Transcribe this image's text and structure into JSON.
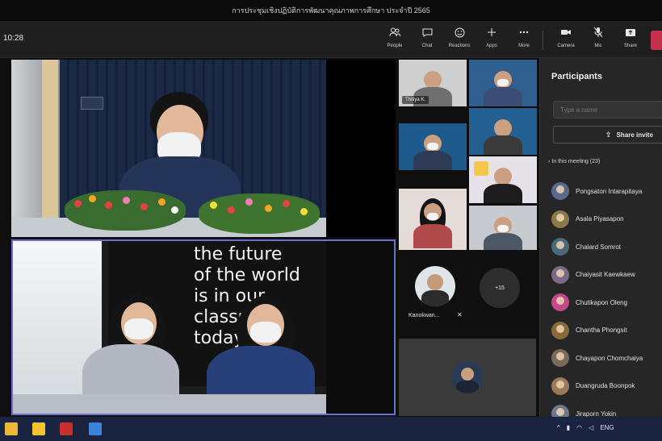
{
  "window": {
    "title": "การประชุมเชิงปฏิบัติการพัฒนาคุณภาพการศึกษา ประจำปี 2565"
  },
  "toolbar": {
    "timer": "10:28",
    "buttons": [
      {
        "label": "People",
        "icon": "people-icon"
      },
      {
        "label": "Chat",
        "icon": "chat-icon"
      },
      {
        "label": "Reactions",
        "icon": "reactions-icon"
      },
      {
        "label": "Apps",
        "icon": "apps-icon"
      },
      {
        "label": "More",
        "icon": "more-icon"
      },
      {
        "label": "Camera",
        "icon": "camera-icon"
      },
      {
        "label": "Mic",
        "icon": "mic-icon"
      },
      {
        "label": "Share",
        "icon": "share-icon"
      }
    ]
  },
  "stage": {
    "board_lines": [
      "the future",
      "of the world",
      "is in our",
      "classroom",
      "today"
    ]
  },
  "grid": {
    "tiles": [
      {
        "name": "Thitiya K.",
        "bg": "#cfcfcf",
        "body": "#6f6f6f"
      },
      {
        "name": "",
        "bg": "#2f5f8f",
        "body": "#3b4d72"
      },
      {
        "name": "",
        "bg": "#1f5a8c",
        "body": "#2e3b56"
      },
      {
        "name": "",
        "bg": "#245f92",
        "body": "#3a3a3a"
      },
      {
        "name": "",
        "bg": "#e7e2ea",
        "body": "#1d1d1d"
      },
      {
        "name": "",
        "bg": "#e4dcd8",
        "body": "#b04a4a"
      },
      {
        "name": "",
        "bg": "#c7cbcf",
        "body": "#4b5866"
      }
    ],
    "avatar_name": "Kanokwan...",
    "more_count": "+15"
  },
  "panel": {
    "title": "Participants",
    "search_placeholder": "Type a name",
    "share_invite": "Share invite",
    "section_label": "In this meeting (23)",
    "participants": [
      {
        "name": "Pongsaton Intarapitaya",
        "color": "#5a6a8a"
      },
      {
        "name": "Asala Piyasapon",
        "color": "#8a7a4a"
      },
      {
        "name": "Chalard Somrot",
        "color": "#4a6a7a"
      },
      {
        "name": "Chaiyasit Kaewkaew",
        "color": "#7a6a8a"
      },
      {
        "name": "Chutikapon Oleng",
        "color": "#c24a8a"
      },
      {
        "name": "Chantha Phongsit",
        "color": "#8a6a3a"
      },
      {
        "name": "Chayapon Chomchaiya",
        "color": "#7a6a5a"
      },
      {
        "name": "Duangruda Boonpok",
        "color": "#9a7a5a"
      },
      {
        "name": "Jiraporn Yokin",
        "color": "#6a7a8a"
      }
    ]
  },
  "taskbar": {
    "tray_time": "ENG"
  }
}
